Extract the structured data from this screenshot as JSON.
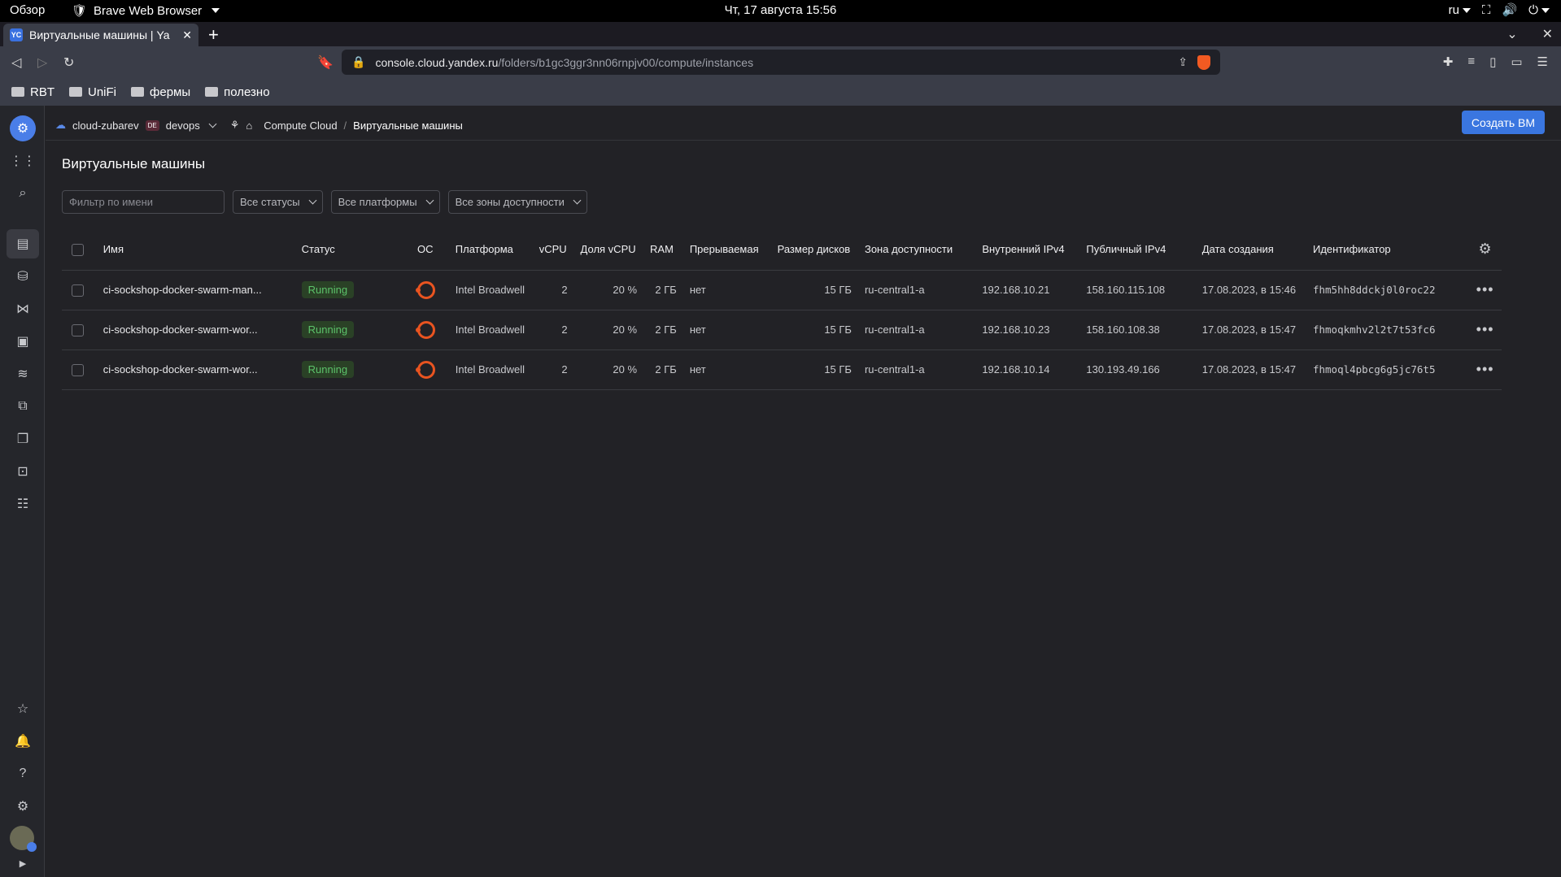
{
  "system": {
    "activities": "Обзор",
    "app_name": "Brave Web Browser",
    "clock": "Чт, 17 августа  15:56",
    "lang": "ru"
  },
  "browser": {
    "tab_title": "Виртуальные машины | Ya",
    "tab_favicon": "YC",
    "url_host": "console.cloud.yandex.ru",
    "url_path": "/folders/b1gc3ggr3nn06rnpjv00/compute/instances",
    "bookmarks": [
      "RBT",
      "UniFi",
      "фермы",
      "полезно"
    ]
  },
  "header": {
    "cloud": "cloud-zubarev",
    "folder_badge": "DE",
    "folder": "devops",
    "breadcrumb_service": "Compute Cloud",
    "breadcrumb_sep": "/",
    "breadcrumb_current": "Виртуальные машины",
    "create_button": "Создать ВМ"
  },
  "page": {
    "title": "Виртуальные машины",
    "filter_placeholder": "Фильтр по имени",
    "filter_status": "Все статусы",
    "filter_platform": "Все платформы",
    "filter_zone": "Все зоны доступности"
  },
  "table": {
    "columns": [
      "Имя",
      "Статус",
      "ОС",
      "Платформа",
      "vCPU",
      "Доля vCPU",
      "RAM",
      "Прерываемая",
      "Размер дисков",
      "Зона доступности",
      "Внутренний IPv4",
      "Публичный IPv4",
      "Дата создания",
      "Идентификатор"
    ],
    "rows": [
      {
        "name": "ci-sockshop-docker-swarm-man...",
        "status": "Running",
        "platform": "Intel Broadwell",
        "vcpu": "2",
        "share": "20 %",
        "ram": "2 ГБ",
        "preemptible": "нет",
        "disk": "15 ГБ",
        "zone": "ru-central1-a",
        "int_ip": "192.168.10.21",
        "pub_ip": "158.160.115.108",
        "created": "17.08.2023, в 15:46",
        "id": "fhm5hh8ddckj0l0roc22"
      },
      {
        "name": "ci-sockshop-docker-swarm-wor...",
        "status": "Running",
        "platform": "Intel Broadwell",
        "vcpu": "2",
        "share": "20 %",
        "ram": "2 ГБ",
        "preemptible": "нет",
        "disk": "15 ГБ",
        "zone": "ru-central1-a",
        "int_ip": "192.168.10.23",
        "pub_ip": "158.160.108.38",
        "created": "17.08.2023, в 15:47",
        "id": "fhmoqkmhv2l2t7t53fc6"
      },
      {
        "name": "ci-sockshop-docker-swarm-wor...",
        "status": "Running",
        "platform": "Intel Broadwell",
        "vcpu": "2",
        "share": "20 %",
        "ram": "2 ГБ",
        "preemptible": "нет",
        "disk": "15 ГБ",
        "zone": "ru-central1-a",
        "int_ip": "192.168.10.14",
        "pub_ip": "130.193.49.166",
        "created": "17.08.2023, в 15:47",
        "id": "fhmoql4pbcg6g5jc76t5"
      }
    ]
  },
  "colors": {
    "accent": "#3a76e0",
    "running": "#5cc26a",
    "ubuntu": "#e95420"
  }
}
